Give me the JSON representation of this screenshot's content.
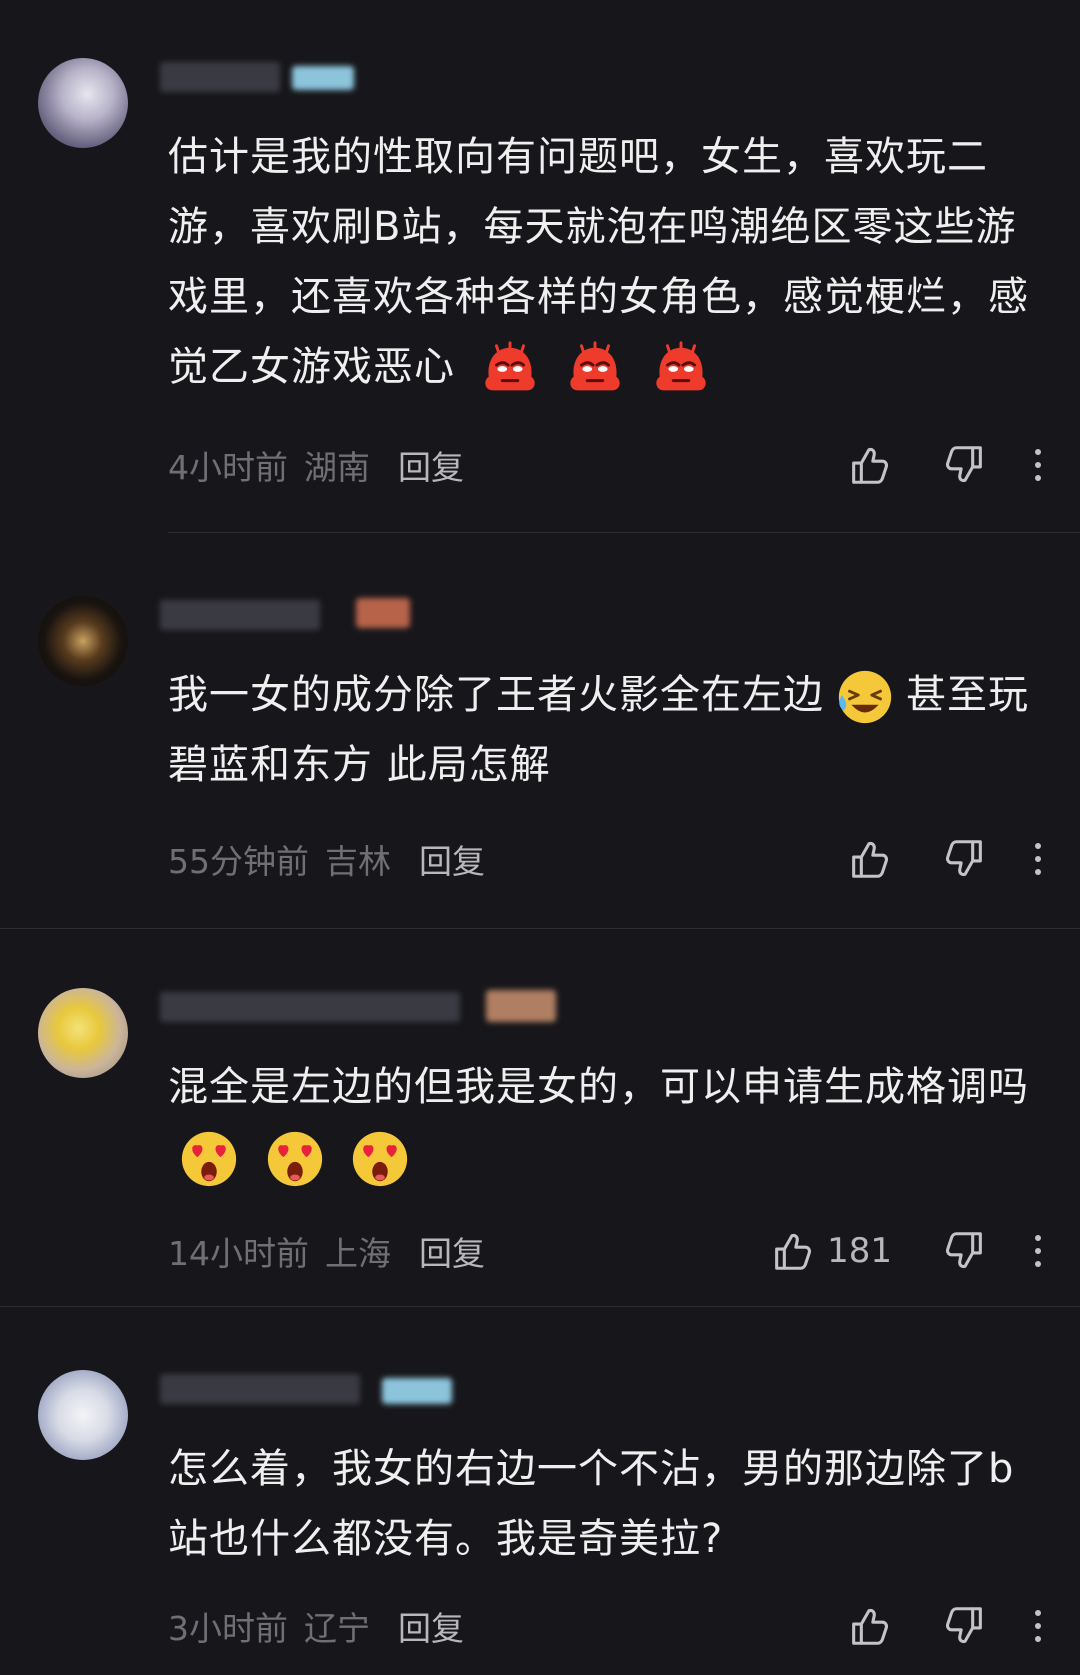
{
  "comments": [
    {
      "text": "估计是我的性取向有问题吧，女生，喜欢玩二游，喜欢刷B站，每天就泡在鸣潮绝区零这些游戏里，还喜欢各种各样的女角色，感觉梗烂，感觉乙女游戏恶心",
      "emojis": [
        "angry-blob-emoji",
        "angry-blob-emoji",
        "angry-blob-emoji"
      ],
      "time": "4小时前",
      "location": "湖南",
      "reply": "回复",
      "likes": ""
    },
    {
      "text": "我一女的成分除了王者火影全在左边",
      "text_after": "甚至玩碧蓝和东方 此局怎解",
      "emojis": [
        "laugh-cry-emoji"
      ],
      "time": "55分钟前",
      "location": "吉林",
      "reply": "回复",
      "likes": ""
    },
    {
      "text": "混全是左边的但我是女的，可以申请生成格调吗",
      "emojis": [
        "heart-eyes-emoji",
        "heart-eyes-emoji",
        "heart-eyes-emoji"
      ],
      "time": "14小时前",
      "location": "上海",
      "reply": "回复",
      "likes": "181"
    },
    {
      "text": "怎么着，我女的右边一个不沾，男的那边除了b站也什么都没有。我是奇美拉?",
      "emojis": [],
      "time": "3小时前",
      "location": "辽宁",
      "reply": "回复",
      "likes": ""
    }
  ],
  "colors": {
    "background": "#17171b",
    "text": "#efefef",
    "meta": "#6f6f74",
    "divider": "#2d2d32"
  }
}
